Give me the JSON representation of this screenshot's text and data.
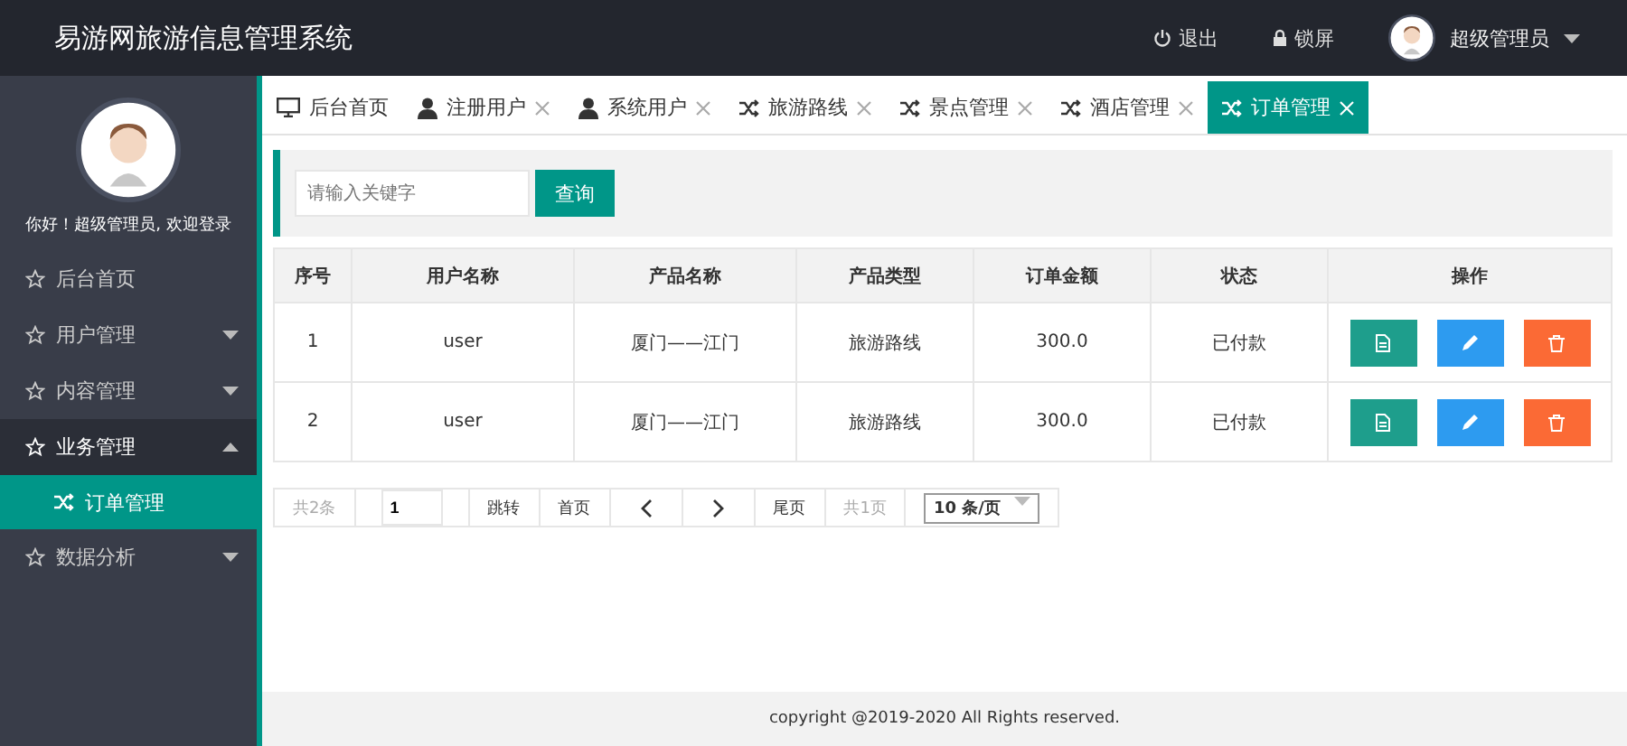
{
  "header": {
    "title": "易游网旅游信息管理系统",
    "logout": "退出",
    "lock": "锁屏",
    "user": "超级管理员"
  },
  "sidebar": {
    "welcome": "你好！超级管理员, 欢迎登录",
    "items": [
      {
        "label": "后台首页",
        "kind": "link",
        "expanded": false
      },
      {
        "label": "用户管理",
        "kind": "group",
        "expanded": false
      },
      {
        "label": "内容管理",
        "kind": "group",
        "expanded": false
      },
      {
        "label": "业务管理",
        "kind": "group",
        "expanded": true,
        "children": [
          {
            "label": "订单管理",
            "selected": true
          }
        ]
      },
      {
        "label": "数据分析",
        "kind": "group",
        "expanded": false
      }
    ]
  },
  "tabs": [
    {
      "label": "后台首页",
      "kind": "monitor",
      "closable": false,
      "selected": false
    },
    {
      "label": "注册用户",
      "kind": "user",
      "closable": true,
      "selected": false
    },
    {
      "label": "系统用户",
      "kind": "user",
      "closable": true,
      "selected": false
    },
    {
      "label": "旅游路线",
      "kind": "shuffle",
      "closable": true,
      "selected": false
    },
    {
      "label": "景点管理",
      "kind": "shuffle",
      "closable": true,
      "selected": false
    },
    {
      "label": "酒店管理",
      "kind": "shuffle",
      "closable": true,
      "selected": false
    },
    {
      "label": "订单管理",
      "kind": "shuffle",
      "closable": true,
      "selected": true
    }
  ],
  "search": {
    "placeholder": "请输入关键字",
    "button": "查询"
  },
  "table": {
    "columns": [
      "序号",
      "用户名称",
      "产品名称",
      "产品类型",
      "订单金额",
      "状态",
      "操作"
    ],
    "rows": [
      {
        "cells": [
          "1",
          "user",
          "厦门——江门",
          "旅游路线",
          "300.0",
          "已付款"
        ]
      },
      {
        "cells": [
          "2",
          "user",
          "厦门——江门",
          "旅游路线",
          "300.0",
          "已付款"
        ]
      }
    ]
  },
  "pagination": {
    "total": "共2条",
    "page": "1",
    "go": "跳转",
    "first": "首页",
    "last": "尾页",
    "pages": "共1页",
    "page_size": "10 条/页"
  },
  "footer": "copyright @2019-2020 All Rights reserved."
}
